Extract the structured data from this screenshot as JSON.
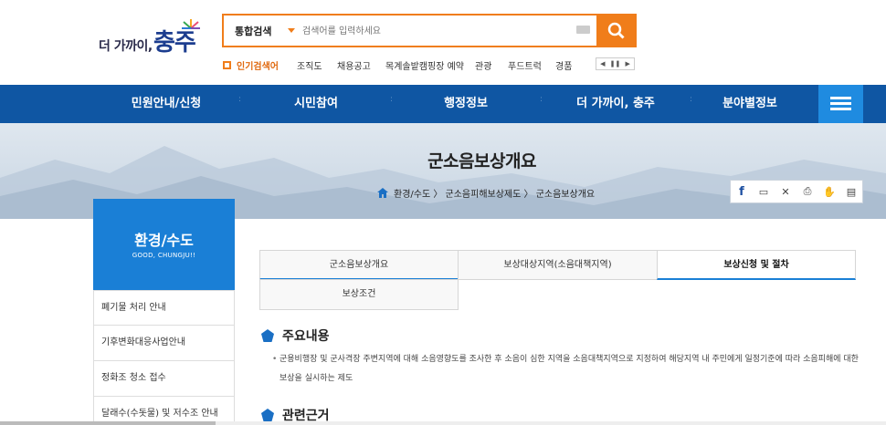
{
  "logo": {
    "small_text": "더 가까이,",
    "big_text": "충주"
  },
  "search": {
    "category": "통합검색",
    "placeholder": "검색어를 입력하세요"
  },
  "hot_keywords": {
    "label": "인기검색어",
    "items": [
      "조직도",
      "채용공고",
      "목계솔밭캠핑장 예약",
      "관광",
      "푸드트럭",
      "경품"
    ]
  },
  "gnb": {
    "items": [
      "민원안내/신청",
      "시민참여",
      "행정정보",
      "더 가까이, 충주",
      "분야별정보"
    ]
  },
  "visual": {
    "title": "군소음보상개요",
    "breadcrumb": [
      "환경/수도",
      "군소음피해보상제도",
      "군소음보상개요"
    ]
  },
  "lnb": {
    "title": "환경/수도",
    "subtitle": "GOOD, CHUNGJU!!",
    "items": [
      "폐기물 처리 안내",
      "기후변화대응사업안내",
      "정화조 청소 접수",
      "달래수(수돗물) 및 저수조 안내"
    ]
  },
  "tabs": [
    "군소음보상개요",
    "보상대상지역(소음대책지역)",
    "보상신청 및 절차",
    "보상조건"
  ],
  "content": {
    "section1_title": "주요내용",
    "section1_text": "군용비행장 및 군사격장 주변지역에 대해 소음영향도를 조사한 후 소음이 심한 지역을 소음대책지역으로 지정하여 해당지역 내 주민에게 일정기준에 따라 소음피해에 대한 보상을 실시하는 제도",
    "section2_title": "관련근거"
  },
  "colors": {
    "accent": "#f07d1a",
    "gnb": "#0f56a3",
    "lnb": "#1a7fd6"
  },
  "icons": [
    "search-icon",
    "keyboard-icon",
    "home-icon",
    "facebook-icon",
    "window-icon",
    "close-icon",
    "print-icon",
    "scrap-icon",
    "document-icon",
    "menu-icon"
  ]
}
